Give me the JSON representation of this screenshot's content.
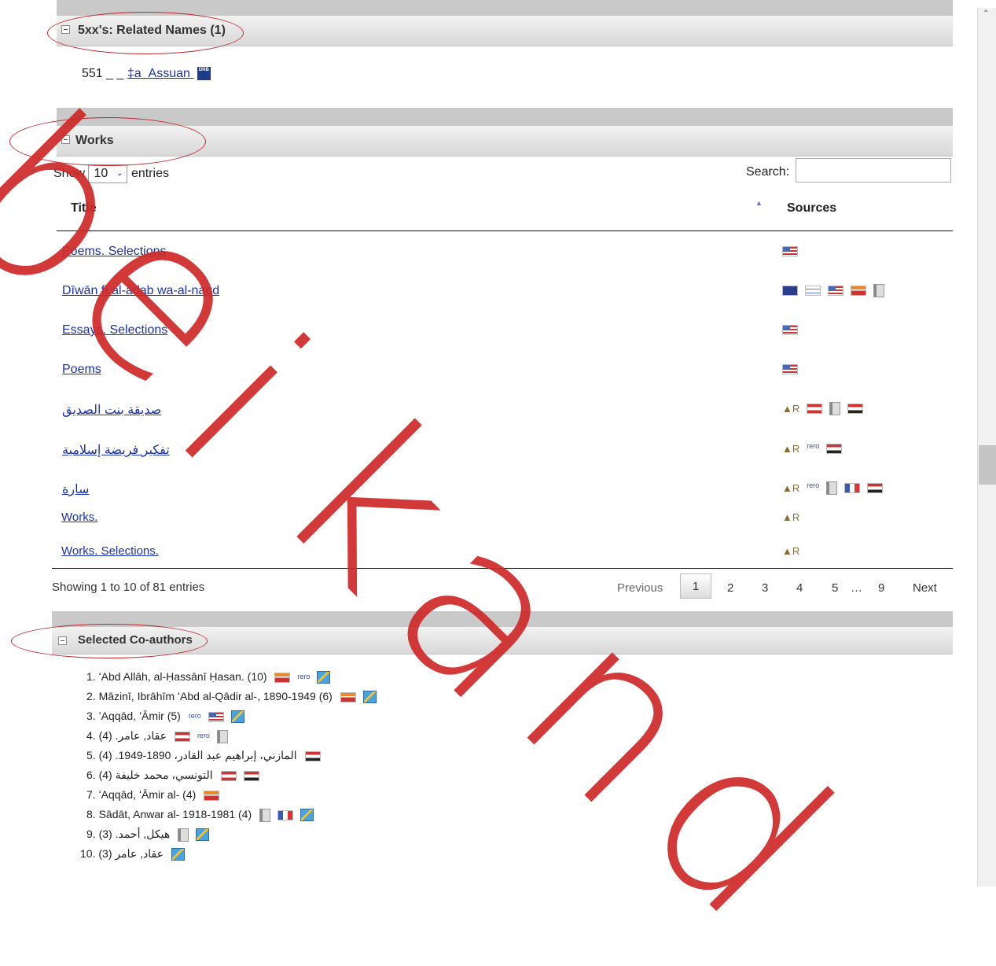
{
  "related_names": {
    "title": "5xx's: Related Names (1)",
    "entry": {
      "tag": "551 _ _",
      "subfield": "‡a",
      "value": "Assuan",
      "source": "DNB"
    }
  },
  "works": {
    "title": "Works",
    "show_label": "Show",
    "entries_value": "10",
    "entries_label": "entries",
    "search_label": "Search:",
    "search_value": "",
    "col_title": "Title",
    "col_sources": "Sources",
    "rows": [
      {
        "title": "Poems. Selections",
        "sources": [
          "us-flag"
        ]
      },
      {
        "title": "Dīwān fī al-adab wa-al-naqd",
        "sources": [
          "au-flag",
          "il-flag",
          "us-flag",
          "sa-flag",
          "book-icon"
        ]
      },
      {
        "title": "Essays. Selections",
        "sources": [
          "us-flag"
        ]
      },
      {
        "title": "Poems",
        "sources": [
          "us-flag"
        ]
      },
      {
        "title": "صديقة بنت الصديق",
        "sources": [
          "xr-icon",
          "lb-flag",
          "book-icon",
          "eg-flag"
        ]
      },
      {
        "title": "تفكير فريضة إسلامية",
        "sources": [
          "xr-icon",
          "rero-icon",
          "eg-flag"
        ]
      },
      {
        "title": "سارة",
        "sources": [
          "xr-icon",
          "rero-icon",
          "book-icon",
          "fr-flag",
          "eg-flag"
        ]
      },
      {
        "title": "Works.",
        "sources": [
          "xr-icon"
        ]
      },
      {
        "title": "Works. Selections.",
        "sources": [
          "xr-icon"
        ]
      }
    ],
    "showing": "Showing 1 to 10 of 81 entries",
    "pager": {
      "previous": "Previous",
      "pages": [
        "1",
        "2",
        "3",
        "4",
        "5"
      ],
      "ellipsis": "…",
      "last": "9",
      "next": "Next"
    }
  },
  "coauthors": {
    "title": "Selected Co-authors",
    "items": [
      {
        "text": "1. ʻAbd Allāh, al-Ḥassānī Ḥasan. (10)",
        "sources": [
          "sa-flag",
          "rero-icon",
          "wkp-icon"
        ]
      },
      {
        "text": "2. Māzinī, Ibrāhīm ʻAbd al-Qādir al-, 1890-1949 (6)",
        "sources": [
          "sa-flag",
          "wkp-icon"
        ]
      },
      {
        "text": "3. ʻAqqād, ʻĀmir (5)",
        "sources": [
          "rero-icon",
          "us-flag",
          "wkp-icon"
        ]
      },
      {
        "text": "4. عقاد, عامر. (4)",
        "sources": [
          "lb-flag",
          "rero-icon",
          "book-icon"
        ]
      },
      {
        "text": "5. المازني، إبراهيم عبد القادر، 1890-1949. (4)",
        "sources": [
          "eg-flag"
        ]
      },
      {
        "text": "6. التونسي، محمد خليفة (4)",
        "sources": [
          "lb-flag",
          "eg-flag"
        ]
      },
      {
        "text": "7. ʻAqqād, ʻĀmir al- (4)",
        "sources": [
          "sa-flag"
        ]
      },
      {
        "text": "8. Sādāt, Anwar al- 1918-1981 (4)",
        "sources": [
          "book-icon",
          "fr-flag",
          "wkp-icon"
        ]
      },
      {
        "text": "9. هيكل, أحمد. (3)",
        "sources": [
          "book-icon",
          "wkp-icon"
        ]
      },
      {
        "text": "10. عقاد, عامر (3)",
        "sources": [
          "wkp-icon"
        ]
      }
    ]
  },
  "watermark": "beikandi"
}
